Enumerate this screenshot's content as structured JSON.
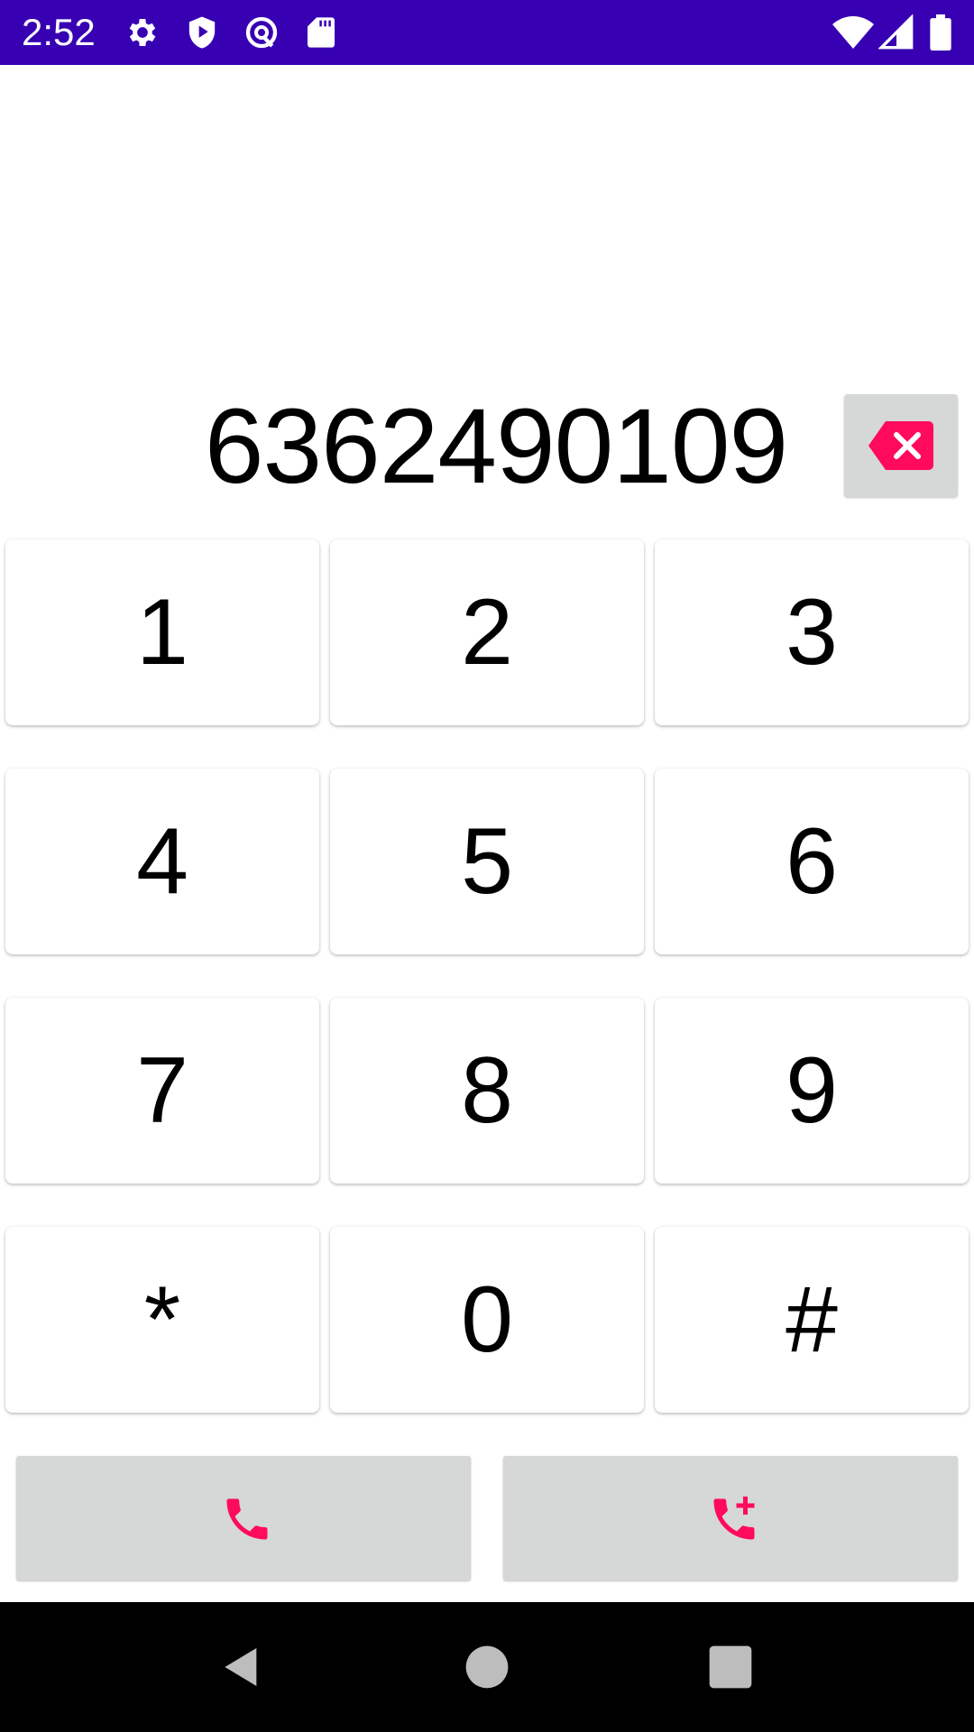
{
  "status_bar": {
    "time": "2:52",
    "left_icons": [
      "settings-icon",
      "shield-play-icon",
      "at-sign-icon",
      "sd-card-icon"
    ],
    "right_icons": [
      "wifi-icon",
      "signal-icon",
      "battery-icon"
    ],
    "background_color": "#3700b3"
  },
  "display": {
    "number": "6362490109"
  },
  "backspace": {
    "icon": "backspace-icon",
    "accent_color": "#ff0a5c"
  },
  "keypad": {
    "keys": [
      "1",
      "2",
      "3",
      "4",
      "5",
      "6",
      "7",
      "8",
      "9",
      "*",
      "0",
      "#"
    ]
  },
  "actions": {
    "call_icon": "phone-icon",
    "add_contact_icon": "phone-add-icon",
    "accent_color": "#ff0a5c"
  },
  "nav_bar": {
    "icons": [
      "back-icon",
      "home-icon",
      "recents-icon"
    ]
  }
}
